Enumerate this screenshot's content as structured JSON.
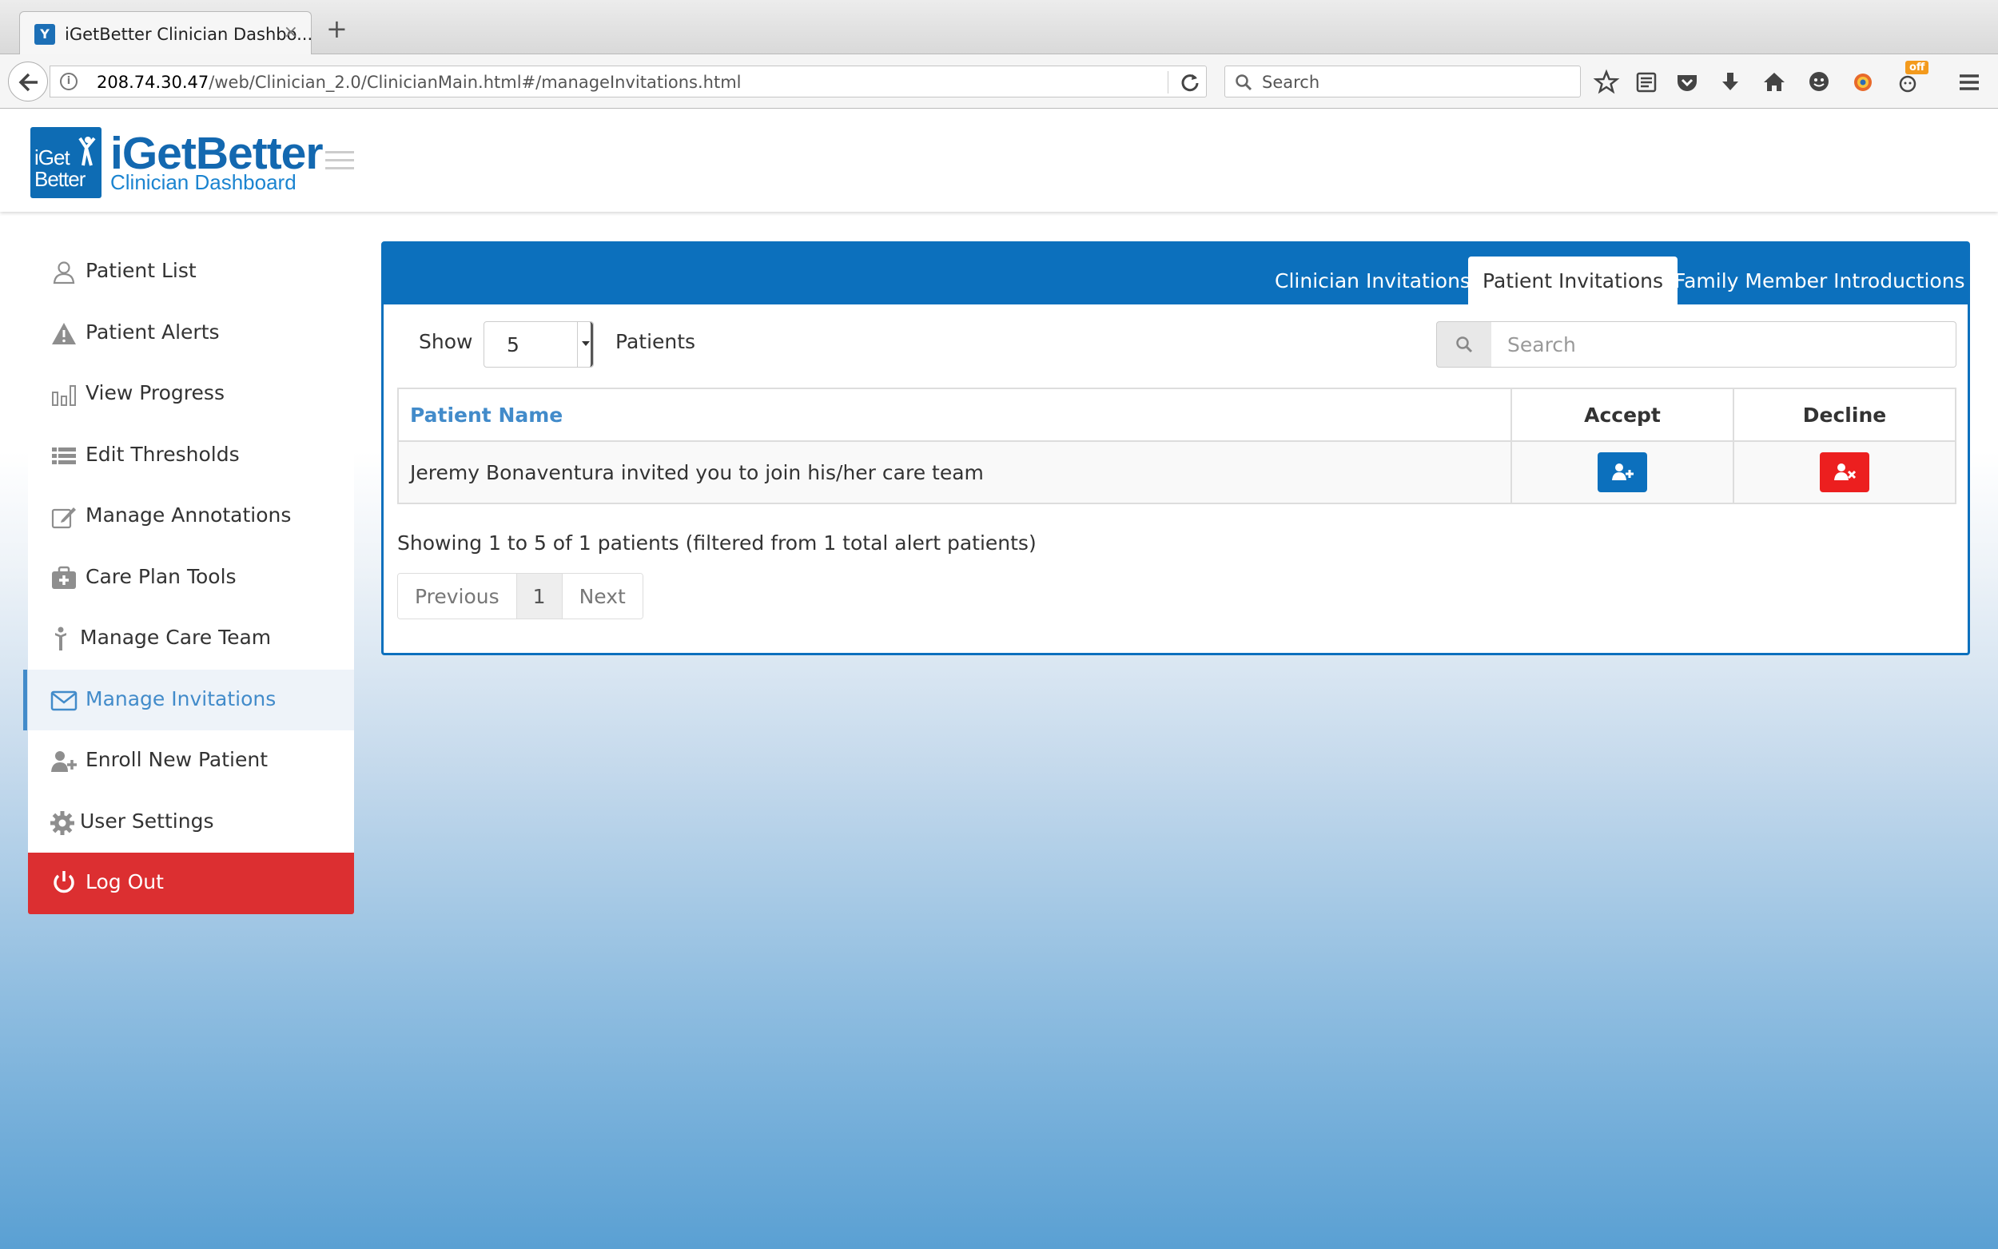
{
  "browser": {
    "tab_title": "iGetBetter Clinician Dashbo...",
    "tab_close": "×",
    "new_tab": "+",
    "url_host": "208.74.30.47",
    "url_path": "/web/Clinician_2.0/ClinicianMain.html#/manageInvitations.html",
    "search_placeholder": "Search",
    "ext_badge": "off"
  },
  "header": {
    "logo_line1": "iGet",
    "logo_line2": "Better",
    "brand_title": "iGetBetter",
    "brand_subtitle": "Clinician Dashboard"
  },
  "sidebar": {
    "items": [
      {
        "label": "Patient List",
        "icon": "user-outline-icon"
      },
      {
        "label": "Patient Alerts",
        "icon": "warning-icon"
      },
      {
        "label": "View Progress",
        "icon": "bar-chart-icon"
      },
      {
        "label": "Edit Thresholds",
        "icon": "list-icon"
      },
      {
        "label": "Manage Annotations",
        "icon": "edit-icon"
      },
      {
        "label": "Care Plan Tools",
        "icon": "medkit-icon"
      },
      {
        "label": "Manage Care Team",
        "icon": "person-icon"
      },
      {
        "label": "Manage Invitations",
        "icon": "envelope-icon",
        "active": true
      },
      {
        "label": "Enroll New Patient",
        "icon": "user-plus-icon"
      },
      {
        "label": "User Settings",
        "icon": "gear-icon"
      },
      {
        "label": "Log Out",
        "icon": "power-icon"
      }
    ]
  },
  "panel": {
    "tabs": [
      {
        "label": "Clinician Invitations"
      },
      {
        "label": "Patient Invitations",
        "active": true
      },
      {
        "label": "Family Member Introductions"
      }
    ],
    "show_label": "Show",
    "page_size": "5",
    "entries_label": "Patients",
    "search_placeholder": "Search",
    "columns": {
      "name": "Patient Name",
      "accept": "Accept",
      "decline": "Decline"
    },
    "rows": [
      {
        "name": "Jeremy Bonaventura invited you to join his/her care team"
      }
    ],
    "info": "Showing 1 to 5 of 1 patients (filtered from 1 total alert patients)",
    "pager": {
      "previous": "Previous",
      "page": "1",
      "next": "Next"
    }
  },
  "colors": {
    "brand_blue": "#0c70bd",
    "active_link": "#428bca",
    "logout_red": "#dc2f31",
    "decline_red": "#ec1f1f"
  }
}
